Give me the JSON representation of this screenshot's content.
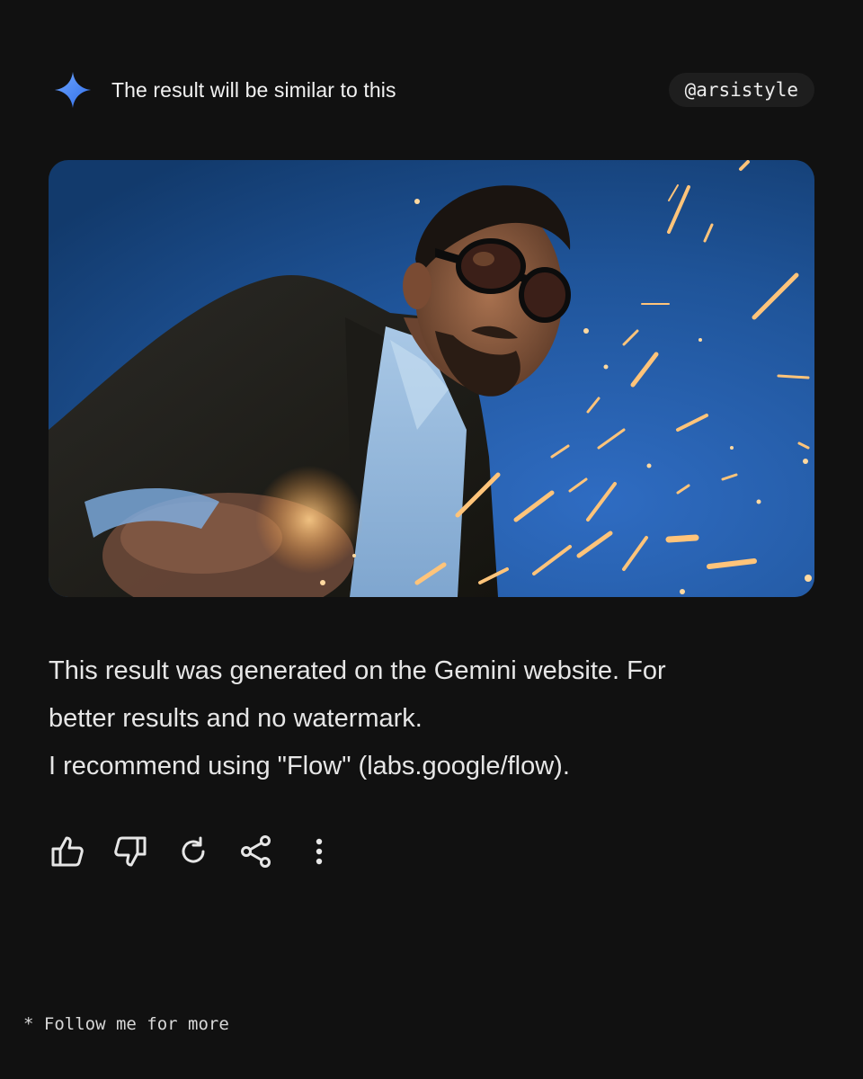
{
  "header": {
    "icon": "gemini-spark-icon",
    "title": "The result will be similar to this",
    "handle": "@arsistyle"
  },
  "image": {
    "subject": "man in sunglasses and tweed blazer with flying sparks against blue evening sky"
  },
  "result": {
    "line1": "This result was generated on the Gemini website. For",
    "line2": "better results and no watermark.",
    "line3": "I recommend using \"Flow\" (labs.google/flow)."
  },
  "actions": [
    {
      "icon": "thumbs-up-icon"
    },
    {
      "icon": "thumbs-down-icon"
    },
    {
      "icon": "regenerate-icon"
    },
    {
      "icon": "share-icon"
    },
    {
      "icon": "more-vertical-icon"
    }
  ],
  "footer": {
    "text": "* Follow me for more"
  },
  "colors": {
    "background": "#111111",
    "accent_blue": "#4f8ff7",
    "text": "#e6e6e6"
  }
}
